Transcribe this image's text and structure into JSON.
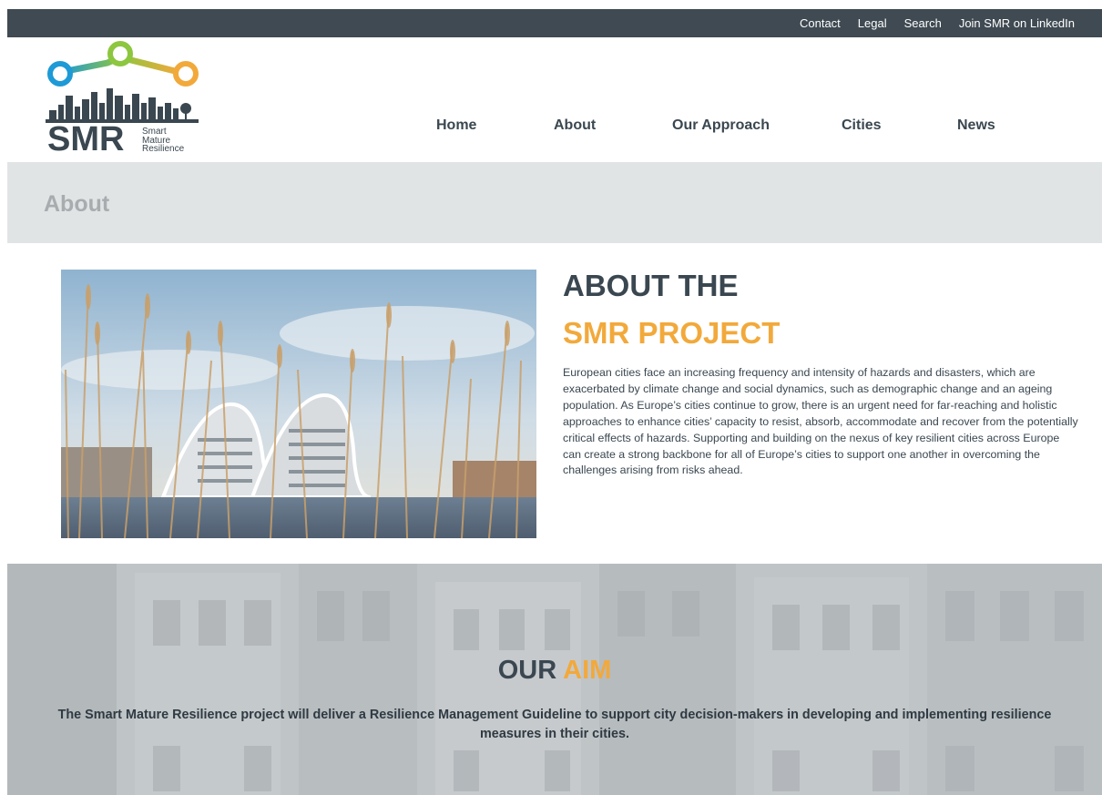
{
  "topbar": {
    "links": [
      "Contact",
      "Legal",
      "Search",
      "Join SMR on LinkedIn"
    ]
  },
  "logo": {
    "wordmark": "SMR",
    "subtitle": [
      "Smart",
      "Mature",
      "Resilience"
    ]
  },
  "nav": {
    "items": [
      "Home",
      "About",
      "Our Approach",
      "Cities",
      "News"
    ]
  },
  "page_title": "About",
  "about": {
    "heading_line1": "ABOUT THE",
    "heading_line2": "SMR PROJECT",
    "body": "European cities face an increasing frequency and intensity of hazards and disasters, which are exacerbated by climate change and social dynamics, such as demographic change and an ageing population. As Europe’s cities continue to grow, there is an urgent need for far-reaching and holistic approaches to enhance cities’ capacity to resist, absorb, accommodate and recover from the potentially critical effects of hazards. Supporting and building on the nexus of key resilient cities across Europe can create a strong backbone for all of Europe’s cities to support one another in overcoming the challenges arising from risks ahead."
  },
  "aim": {
    "heading_part1": "OUR",
    "heading_part2": "AIM",
    "body": "The Smart Mature Resilience project will deliver a Resilience Management Guideline to support city decision-makers in developing and implementing resilience measures in their cities."
  },
  "colors": {
    "dark": "#3a4750",
    "accent": "#f2a93b",
    "topbar": "#3f4a52",
    "band": "#e1e4e5"
  }
}
